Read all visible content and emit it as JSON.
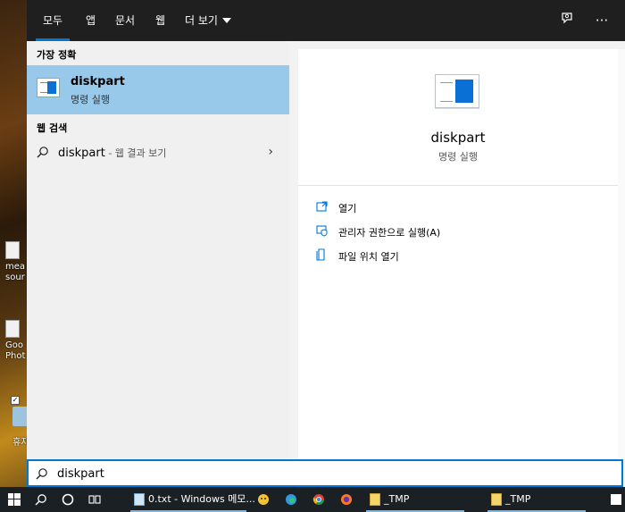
{
  "tabs": [
    {
      "label": "모두"
    },
    {
      "label": "앱"
    },
    {
      "label": "문서"
    },
    {
      "label": "웹"
    },
    {
      "label": "더 보기"
    }
  ],
  "best_match": {
    "header": "가장 정확",
    "title": "diskpart",
    "subtitle": "명령 실행"
  },
  "web_search": {
    "header": "웹 검색",
    "query": "diskpart",
    "hint": " - 웹 결과 보기"
  },
  "preview": {
    "title": "diskpart",
    "subtitle": "명령 실행",
    "actions": [
      {
        "label": "열기",
        "icon": "open-icon"
      },
      {
        "label": "관리자 권한으로 실행(A)",
        "icon": "admin-shield-icon"
      },
      {
        "label": "파일 위치 열기",
        "icon": "file-location-icon"
      }
    ]
  },
  "search": {
    "value": "diskpart"
  },
  "desktop_icons": [
    {
      "label": "mea"
    },
    {
      "label": "sour"
    },
    {
      "label": "Goo"
    },
    {
      "label": "Phot"
    },
    {
      "label": "휴지"
    }
  ],
  "taskbar": {
    "apps": [
      {
        "label": "0.txt - Windows 메모...",
        "icon": "notepad-icon"
      },
      {
        "label": "_TMP",
        "icon": "folder-icon"
      },
      {
        "label": "_TMP",
        "icon": "folder-icon"
      }
    ]
  },
  "colors": {
    "accent": "#0078d7",
    "selected_bg": "#99c9ea",
    "topbar_bg": "#1f1f1f",
    "taskbar_bg": "#1b2025"
  }
}
